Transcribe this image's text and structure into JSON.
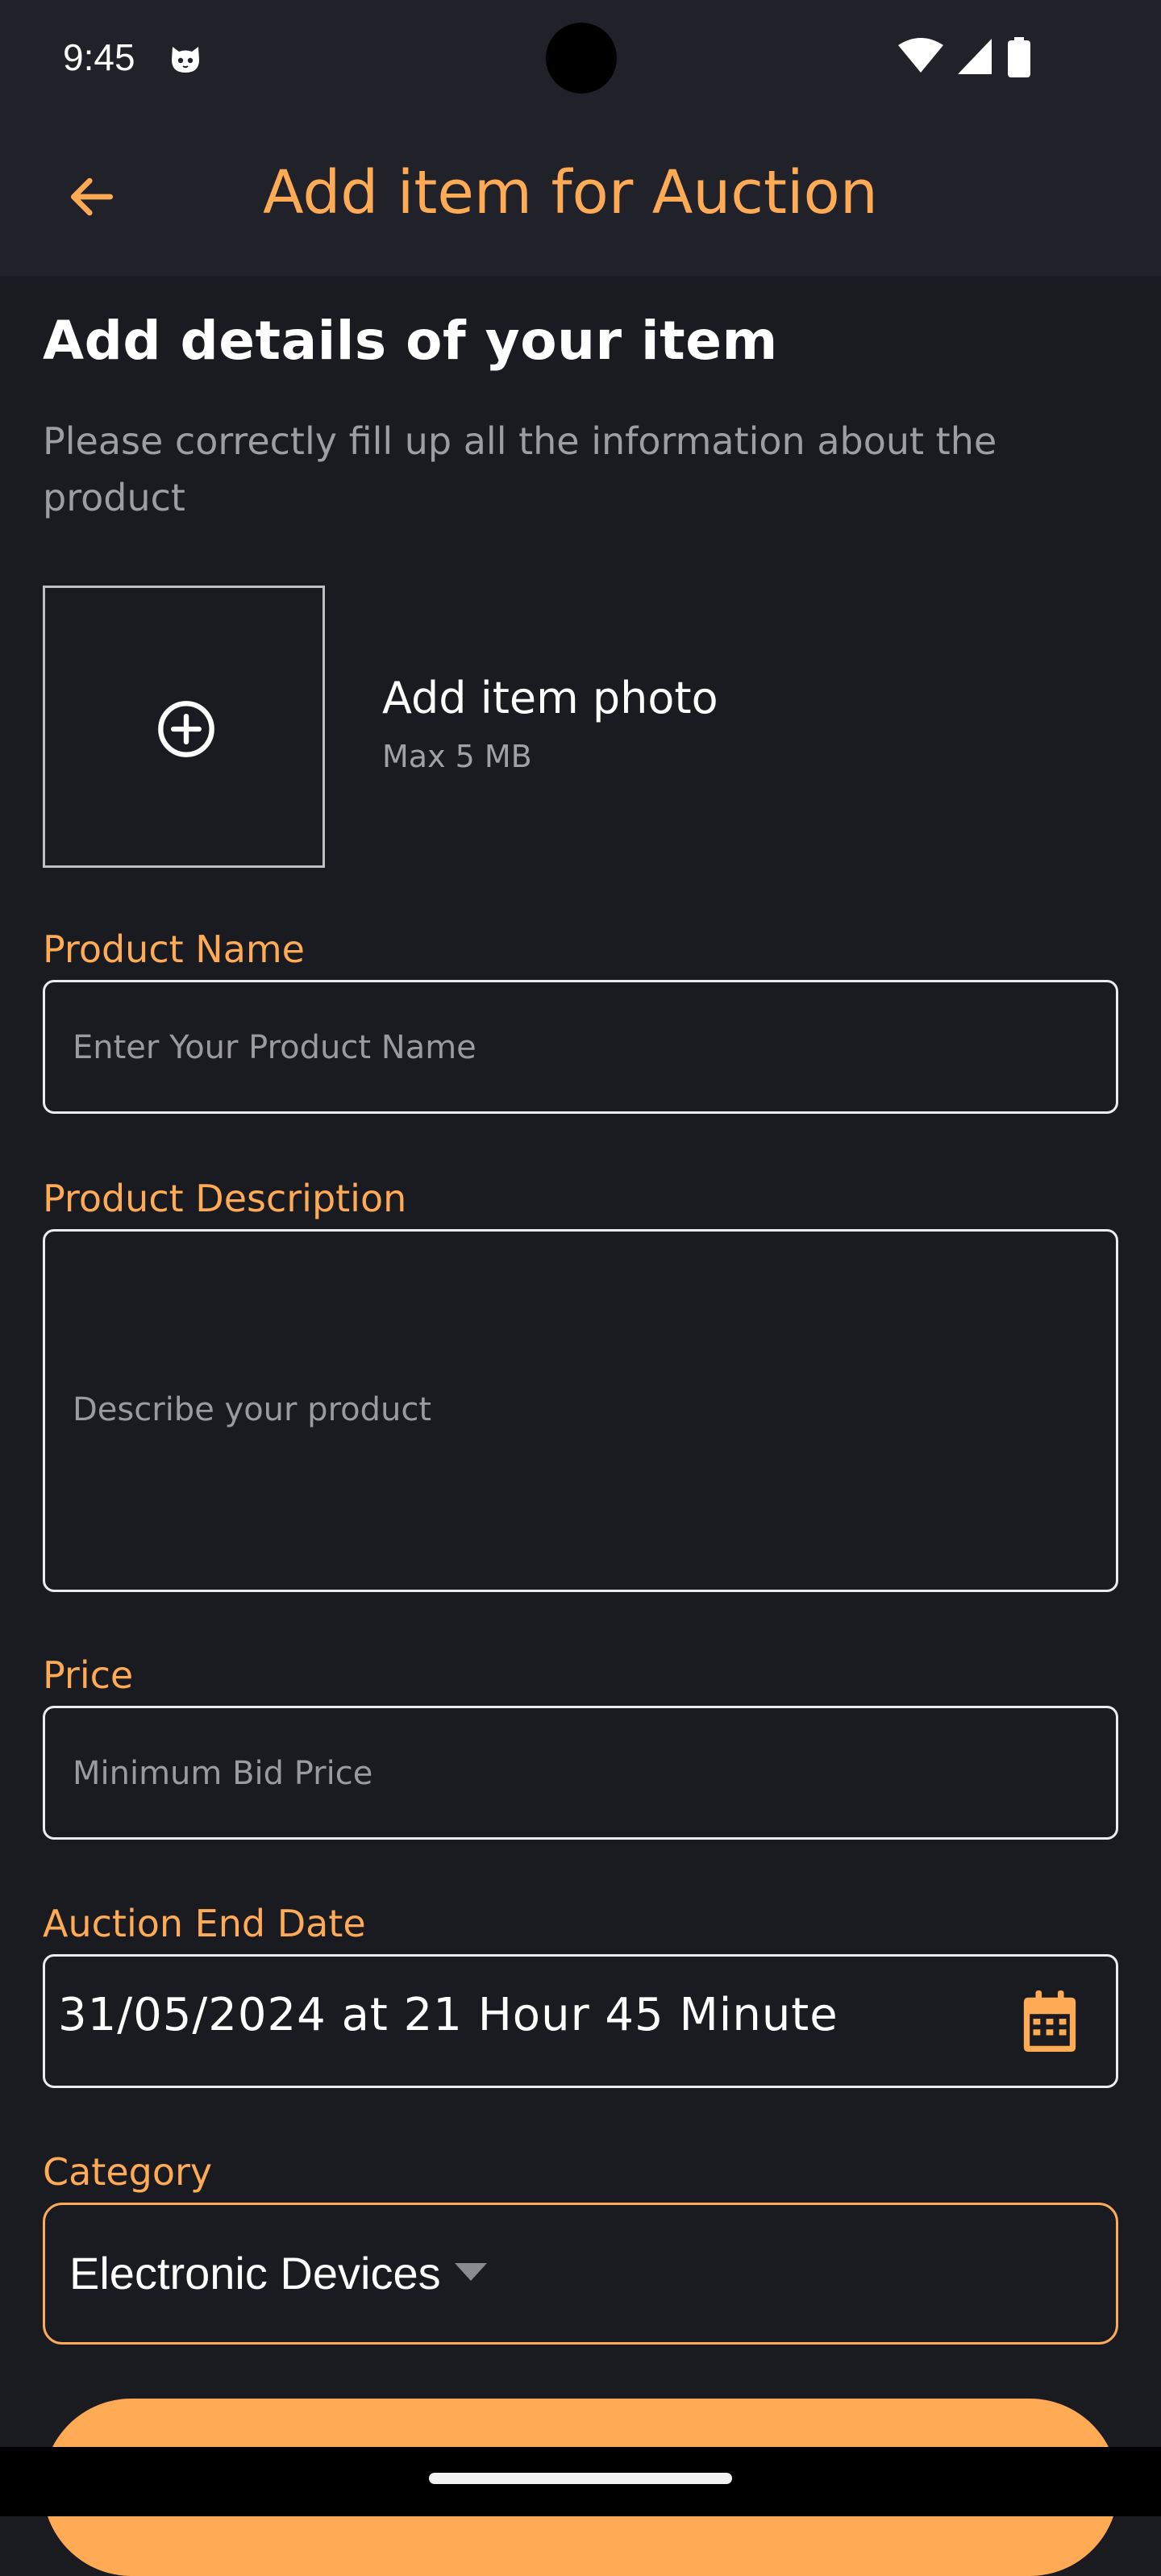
{
  "status_bar": {
    "time": "9:45",
    "icons": [
      "cat-notification-icon",
      "wifi-icon",
      "cellular-signal-icon",
      "battery-icon"
    ]
  },
  "app_bar": {
    "title": "Add item for Auction",
    "back_icon": "arrow-left-icon"
  },
  "form": {
    "heading": "Add details of your item",
    "subtext": "Please correctly fill up all the information about the product",
    "photo": {
      "label": "Add item photo",
      "hint": "Max 5 MB",
      "icon": "plus-circle-icon"
    },
    "product_name": {
      "label": "Product Name",
      "placeholder": "Enter Your Product Name",
      "value": ""
    },
    "product_description": {
      "label": "Product Description",
      "placeholder": "Describe your product",
      "value": ""
    },
    "price": {
      "label": "Price",
      "placeholder": "Minimum Bid Price",
      "value": ""
    },
    "auction_end_date": {
      "label": "Auction End Date",
      "value": "31/05/2024 at 21 Hour 45 Minute",
      "icon": "calendar-icon"
    },
    "category": {
      "label": "Category",
      "selected": "Electronic Devices",
      "icon": "dropdown-arrow-icon"
    }
  },
  "colors": {
    "accent": "#ffaa55",
    "background": "#1a1b20",
    "app_bar": "#212129",
    "text_primary": "#ffffff",
    "text_secondary": "#9d9ea4",
    "field_border": "#ececee"
  }
}
